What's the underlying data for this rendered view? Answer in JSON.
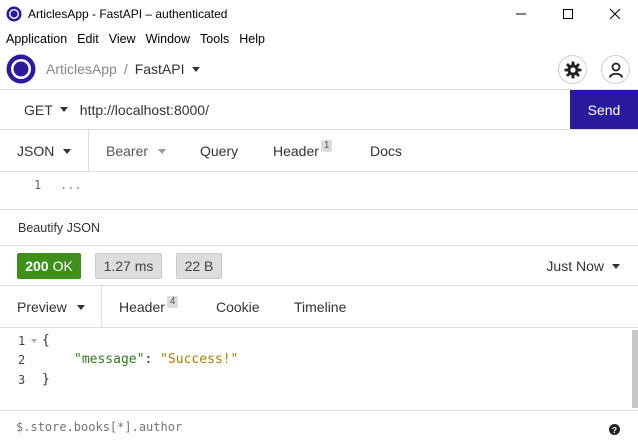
{
  "window": {
    "title": "ArticlesApp - FastAPI – authenticated",
    "controls": [
      "minimize",
      "maximize",
      "close"
    ]
  },
  "menubar": {
    "items": [
      "Application",
      "Edit",
      "View",
      "Window",
      "Tools",
      "Help"
    ]
  },
  "header": {
    "app_name": "ArticlesApp",
    "separator": "/",
    "environment": "FastAPI",
    "icons": [
      "settings-gear-icon",
      "account-icon"
    ]
  },
  "request": {
    "method": "GET",
    "url": "http://localhost:8000/",
    "send_label": "Send"
  },
  "request_tabs": {
    "body": "JSON",
    "auth": "Bearer",
    "query": "Query",
    "header": "Header",
    "header_count": "1",
    "docs": "Docs"
  },
  "request_body": {
    "line_number": "1",
    "content": "..."
  },
  "beautify_label": "Beautify JSON",
  "response_status": {
    "code": "200",
    "text": "OK",
    "time": "1.27 ms",
    "size": "22 B",
    "history": "Just Now",
    "ok_color": "#3f8f1b"
  },
  "response_tabs": {
    "preview": "Preview",
    "header": "Header",
    "header_count": "4",
    "cookie": "Cookie",
    "timeline": "Timeline"
  },
  "response_body": {
    "line_numbers": [
      "1",
      "2",
      "3"
    ],
    "open_brace": "{",
    "key": "\"message\"",
    "colon": ": ",
    "value": "\"Success!\"",
    "close_brace": "}"
  },
  "filter": {
    "placeholder": "$.store.books[*].author",
    "help_icon": "?"
  },
  "colors": {
    "accent": "#2a1b9e",
    "json_key": "#2e7d1a",
    "json_string": "#b07a00"
  }
}
